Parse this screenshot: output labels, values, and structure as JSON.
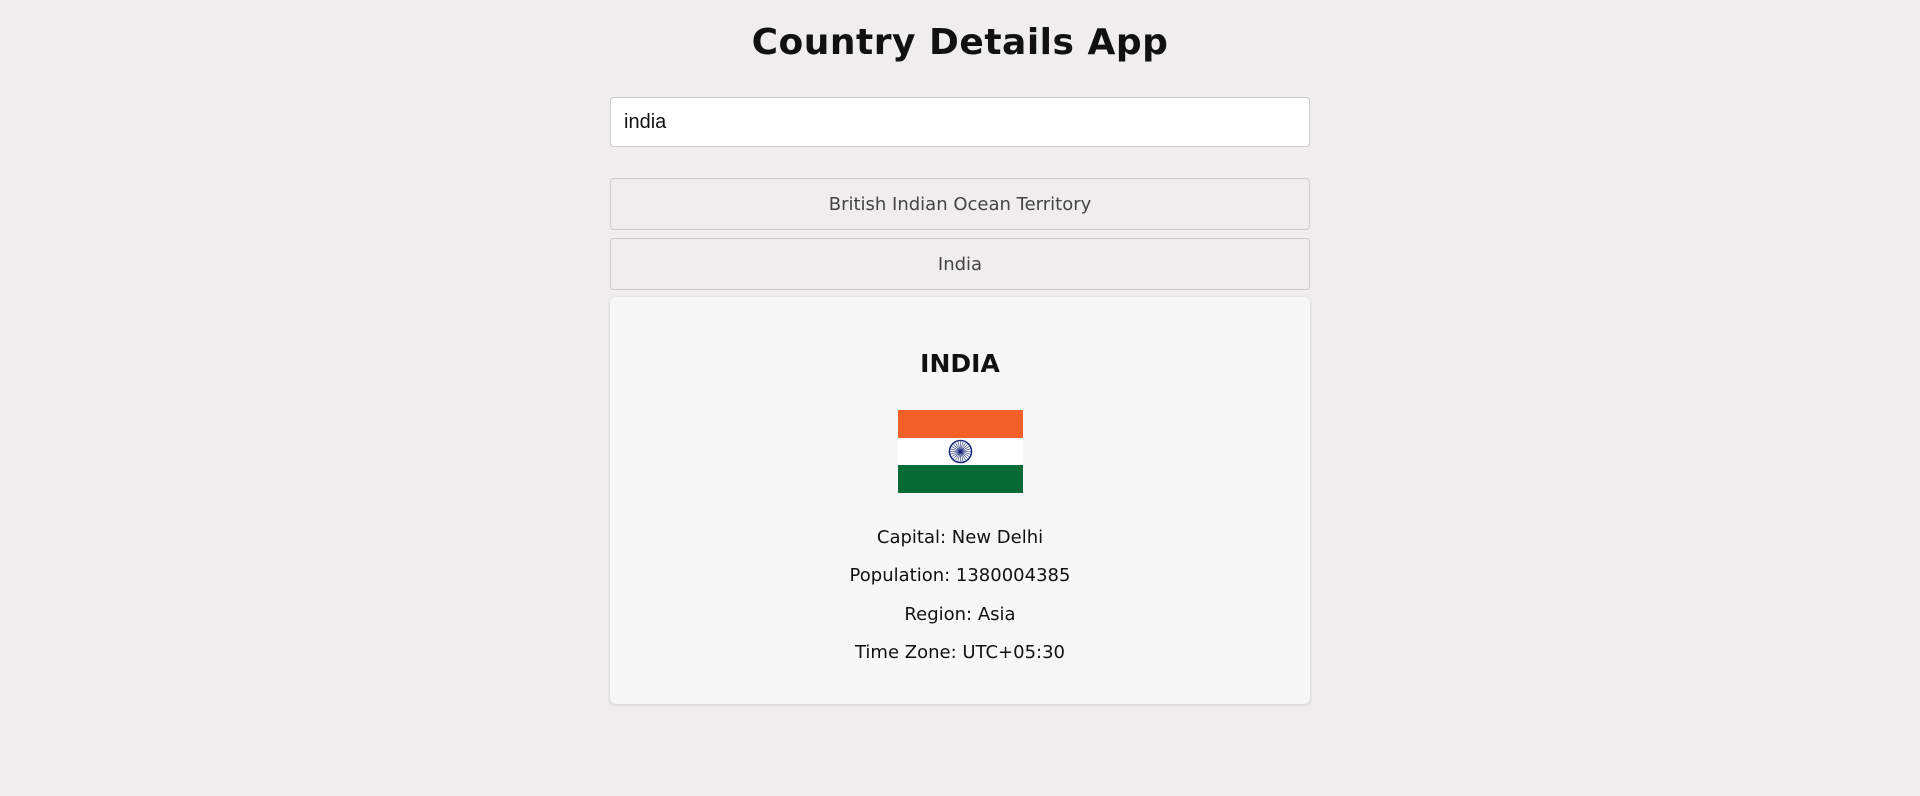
{
  "app": {
    "title": "Country Details App"
  },
  "search": {
    "value": "india",
    "placeholder": ""
  },
  "results": [
    {
      "label": "British Indian Ocean Territory"
    },
    {
      "label": "India"
    }
  ],
  "details": {
    "name": "INDIA",
    "capital": "Capital: New Delhi",
    "population": "Population: 1380004385",
    "region": "Region: Asia",
    "timezone": "Time Zone: UTC+05:30",
    "flag_colors": {
      "saffron": "#f26028",
      "white": "#ffffff",
      "green": "#066a37",
      "chakra": "#1d2b7a"
    }
  }
}
